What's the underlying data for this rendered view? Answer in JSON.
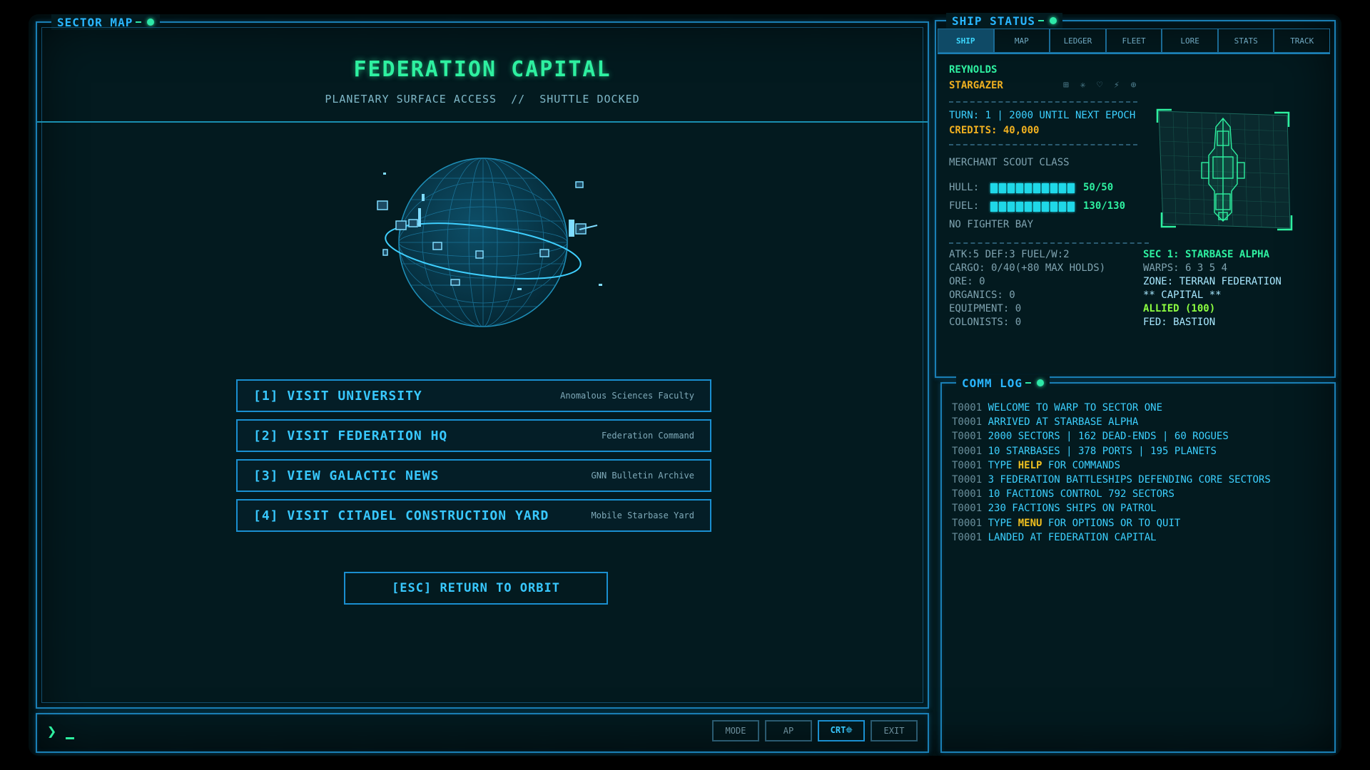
{
  "sector": {
    "title": "SECTOR MAP",
    "location_title": "FEDERATION CAPITAL",
    "location_sub": "PLANETARY SURFACE ACCESS  //  SHUTTLE DOCKED",
    "menu": [
      {
        "label": "[1] VISIT UNIVERSITY",
        "sub": "Anomalous Sciences Faculty"
      },
      {
        "label": "[2] VISIT FEDERATION HQ",
        "sub": "Federation Command"
      },
      {
        "label": "[3] VIEW GALACTIC NEWS",
        "sub": "GNN Bulletin Archive"
      },
      {
        "label": "[4] VISIT CITADEL CONSTRUCTION YARD",
        "sub": "Mobile Starbase Yard"
      }
    ],
    "esc_label": "[ESC] RETURN TO ORBIT"
  },
  "command": {
    "prompt": "❯",
    "buttons": [
      "MODE",
      "AP",
      "CRT⯐",
      "EXIT"
    ]
  },
  "ship": {
    "title": "SHIP STATUS",
    "tabs": [
      "SHIP",
      "MAP",
      "LEDGER",
      "FLEET",
      "LORE",
      "STATS",
      "TRACK"
    ],
    "pilot": "REYNOLDS",
    "name": "STARGAZER",
    "icons": "⊞ ✳ ♡ ⚡ ⊕",
    "turn": "TURN: 1 | 2000 UNTIL NEXT EPOCH",
    "credits": "CREDITS: 40,000",
    "class": "MERCHANT SCOUT CLASS",
    "hull_label": "HULL:",
    "hull_value": "50/50",
    "hull_fraction": 1.0,
    "fuel_label": "FUEL:",
    "fuel_value": "130/130",
    "fuel_fraction": 1.0,
    "fighter": "NO FIGHTER BAY",
    "stats_left": [
      "ATK:5 DEF:3 FUEL/W:2",
      "CARGO: 0/40(+80 MAX HOLDS)",
      "ORE: 0",
      "ORGANICS: 0",
      "EQUIPMENT: 0",
      "COLONISTS: 0"
    ],
    "sector_name": "SEC 1: STARBASE ALPHA",
    "warps": "WARPS: 6 3 5 4",
    "zone": "ZONE: TERRAN FEDERATION",
    "capital": "** CAPITAL **",
    "allied": "ALLIED (100)",
    "fed": "FED: BASTION"
  },
  "comm": {
    "title": "COMM LOG",
    "lines": [
      {
        "t": "T0001",
        "pre": "WELCOME TO WARP TO SECTOR ONE",
        "hl": "",
        "post": ""
      },
      {
        "t": "T0001",
        "pre": "ARRIVED AT STARBASE ALPHA",
        "hl": "",
        "post": ""
      },
      {
        "t": "T0001",
        "pre": "2000 SECTORS | 162 DEAD-ENDS | 60 ROGUES",
        "hl": "",
        "post": ""
      },
      {
        "t": "T0001",
        "pre": "10 STARBASES | 378 PORTS | 195 PLANETS",
        "hl": "",
        "post": ""
      },
      {
        "t": "T0001",
        "pre": "TYPE ",
        "hl": "HELP",
        "post": " FOR COMMANDS"
      },
      {
        "t": "T0001",
        "pre": "3 FEDERATION BATTLESHIPS DEFENDING CORE SECTORS",
        "hl": "",
        "post": ""
      },
      {
        "t": "T0001",
        "pre": "10 FACTIONS CONTROL 792 SECTORS",
        "hl": "",
        "post": ""
      },
      {
        "t": "T0001",
        "pre": "230 FACTIONS SHIPS ON PATROL",
        "hl": "",
        "post": ""
      },
      {
        "t": "T0001",
        "pre": "TYPE ",
        "hl": "MENU",
        "post": " FOR OPTIONS OR TO QUIT"
      },
      {
        "t": "T0001",
        "pre": "LANDED AT FEDERATION CAPITAL",
        "hl": "",
        "post": ""
      }
    ]
  }
}
